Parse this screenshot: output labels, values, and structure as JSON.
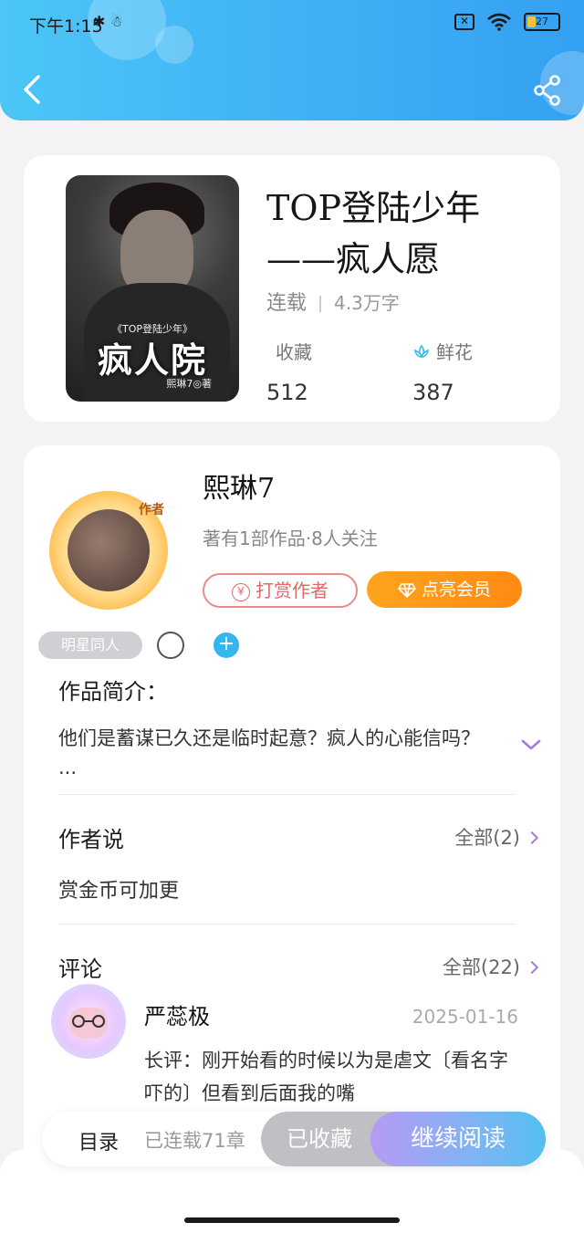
{
  "status_bar": {
    "time": "下午1:15",
    "left_icons": "✱ ☃",
    "sim_label": "✕",
    "battery_level": "27",
    "battery_fraction": 0.27
  },
  "book": {
    "cover_subtitle": "《TOP登陆少年》",
    "cover_title": "疯人院",
    "cover_author": "熙琳7◎著",
    "title_line1": "TOP登陆少年",
    "title_line2": "——疯人愿",
    "status": "连载",
    "word_count": "4.3万字",
    "favorites_label": "收藏",
    "favorites_value": "512",
    "flowers_label": "鲜花",
    "flowers_value": "387"
  },
  "author": {
    "badge": "作者",
    "name": "熙琳7",
    "meta": "著有1部作品·8人关注",
    "tip_label": "打赏作者",
    "tip_icon_text": "¥",
    "vip_label": "点亮会员"
  },
  "tags": {
    "pill_label": "明星同人",
    "add_label": "+"
  },
  "intro": {
    "title": "作品简介：",
    "text": "他们是蓄谋已久还是临时起意？疯人的心能信吗？···"
  },
  "author_say": {
    "title": "作者说",
    "more": "全部(2)",
    "text": "赏金币可加更"
  },
  "comments": {
    "title": "评论",
    "more": "全部(22)",
    "items": [
      {
        "name": "严蕊极",
        "date": "2025-01-16",
        "text": "长评：刚开始看的时候以为是虐文〔看名字吓的〕但看到后面我的嘴"
      }
    ]
  },
  "action_bar": {
    "toc_label": "目录",
    "serial_label": "已连载71章",
    "fav_label": "已收藏",
    "read_label": "继续阅读"
  },
  "colors": {
    "header_start": "#4cc6f6",
    "header_end": "#34a0f2",
    "vip_orange": "#ff9a1a",
    "tip_red": "#e06a6a",
    "chevron_purple": "#a77bd9"
  }
}
